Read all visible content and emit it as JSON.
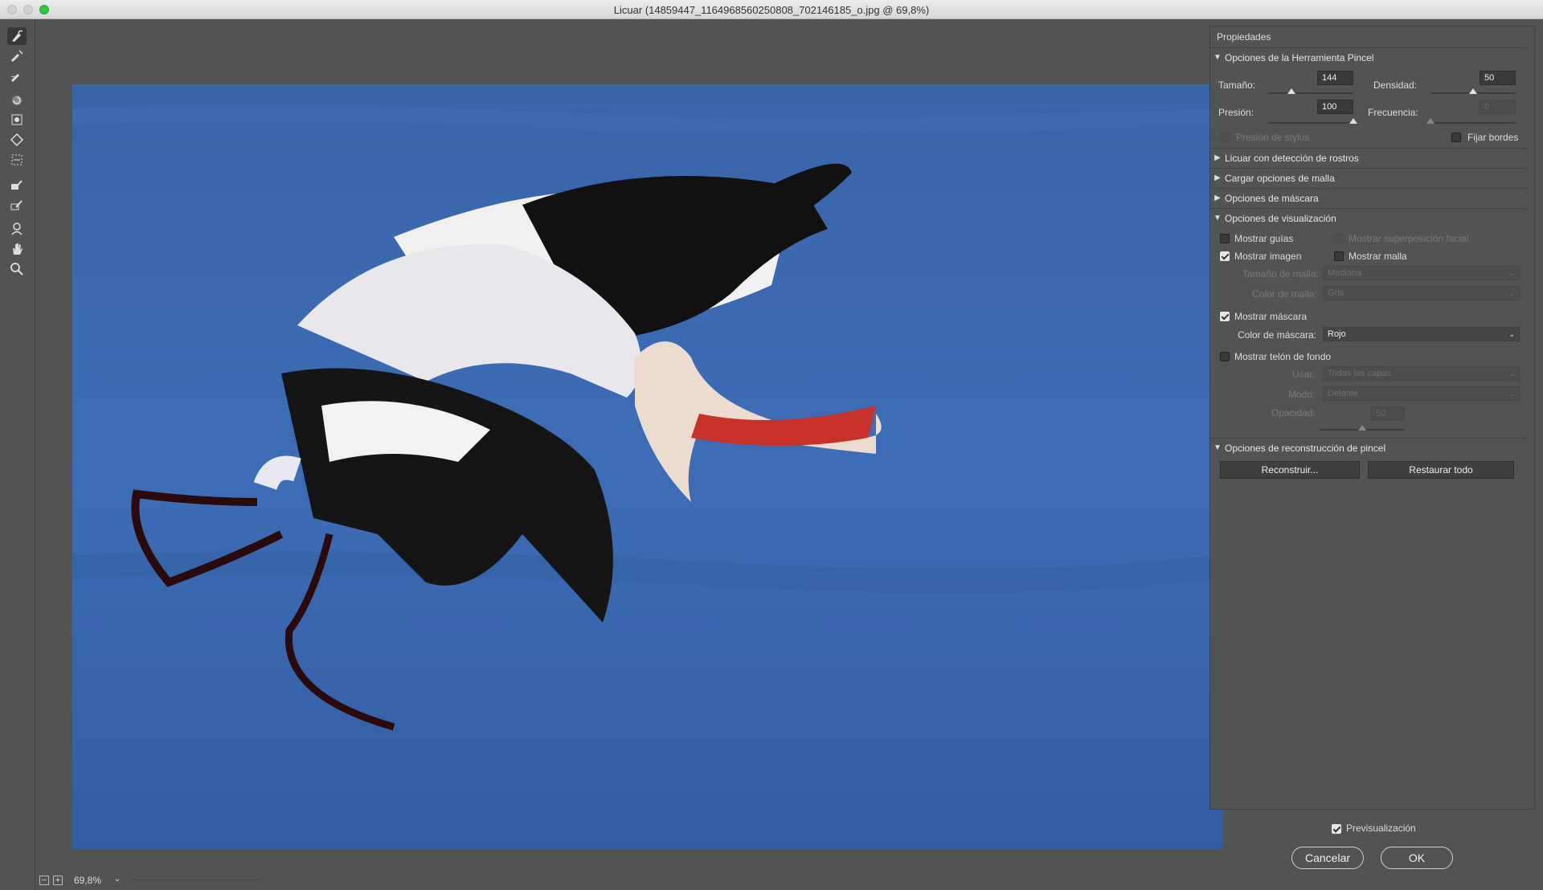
{
  "window": {
    "title": "Licuar (14859447_1164968560250808_702146185_o.jpg @ 69,8%)"
  },
  "toolbar": {
    "tools": [
      "warp-brush-icon",
      "reconstruct-brush-icon",
      "smooth-brush-icon",
      "twirl-clockwise-icon",
      "pucker-icon",
      "bloat-icon",
      "push-left-icon",
      "freeze-mask-icon",
      "thaw-mask-icon",
      "face-tool-icon",
      "hand-icon",
      "zoom-icon"
    ]
  },
  "status": {
    "zoom": "69,8%",
    "zoom_out": "−",
    "zoom_in": "+",
    "dropdown": "⌄"
  },
  "panel": {
    "title": "Propiedades",
    "brush": {
      "header": "Opciones de la Herramienta Pincel",
      "size_label": "Tamaño:",
      "size_value": "144",
      "size_level": 0.27,
      "density_label": "Densidad:",
      "density_value": "50",
      "density_level": 0.5,
      "pressure_label": "Presión:",
      "pressure_value": "100",
      "pressure_level": 1.0,
      "frequency_label": "Frecuencia:",
      "frequency_value": "0",
      "frequency_level": 0.0,
      "stylus_label": "Presión de stylus",
      "pin_edges_label": "Fijar bordes"
    },
    "face": {
      "header": "Licuar con detección de rostros"
    },
    "mesh": {
      "header": "Cargar opciones de malla"
    },
    "mask": {
      "header": "Opciones de máscara"
    },
    "view": {
      "header": "Opciones de visualización",
      "show_guides": "Mostrar guías",
      "show_face_overlay": "Mostrar superposición facial",
      "show_image": "Mostrar imagen",
      "show_mesh": "Mostrar malla",
      "mesh_size_label": "Tamaño de malla:",
      "mesh_size_value": "Mediana",
      "mesh_color_label": "Color de malla:",
      "mesh_color_value": "Gris",
      "show_mask": "Mostrar máscara",
      "mask_color_label": "Color de máscara:",
      "mask_color_value": "Rojo",
      "show_backdrop": "Mostrar telón de fondo",
      "use_label": "Usar:",
      "use_value": "Todas las capas",
      "mode_label": "Modo:",
      "mode_value": "Delante",
      "opacity_label": "Opacidad:",
      "opacity_value": "50",
      "opacity_level": 0.5
    },
    "reconstruct": {
      "header": "Opciones de reconstrucción de pincel",
      "reconstruct_btn": "Reconstruir...",
      "restore_btn": "Restaurar todo"
    },
    "preview_label": "Previsualización",
    "cancel": "Cancelar",
    "ok": "OK"
  },
  "colors": {
    "accent_green": "#2fc941",
    "panel_bg": "#535353",
    "water": "#3d69b0",
    "beak": "#c8302a"
  }
}
